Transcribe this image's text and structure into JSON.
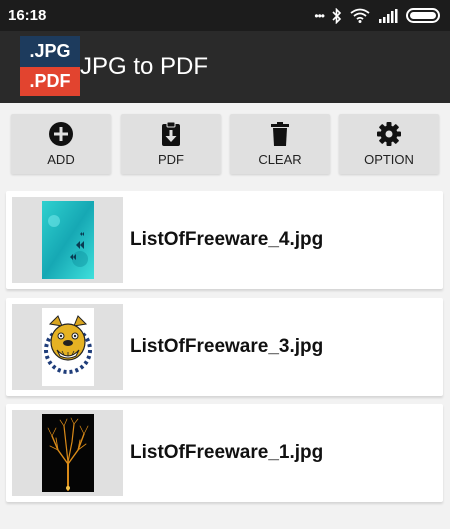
{
  "status_bar": {
    "time": "16:18",
    "icons": [
      "more-dots-icon",
      "bluetooth-icon",
      "wifi-icon",
      "signal-icon",
      "battery-icon"
    ],
    "dots": "•••"
  },
  "app": {
    "logo_top": ".JPG",
    "logo_bottom": ".PDF",
    "title": "JPG to PDF"
  },
  "actions": [
    {
      "label": "ADD",
      "icon": "plus-circle-icon"
    },
    {
      "label": "PDF",
      "icon": "clipboard-download-icon"
    },
    {
      "label": "CLEAR",
      "icon": "trash-icon"
    },
    {
      "label": "OPTION",
      "icon": "gear-icon"
    }
  ],
  "files": [
    {
      "name": "ListOfFreeware_4.jpg",
      "thumb": "teal-butterflies-image"
    },
    {
      "name": "ListOfFreeware_3.jpg",
      "thumb": "bulldog-mascot-image"
    },
    {
      "name": "ListOfFreeware_1.jpg",
      "thumb": "golden-tree-image"
    }
  ],
  "colors": {
    "status_bar": "#1c1c1c",
    "app_bar": "#2a2a2a",
    "logo_blue": "#1d3b5d",
    "logo_red": "#e2442f",
    "button_bg": "#e0e0e0",
    "page_bg": "#f2f2f2"
  }
}
